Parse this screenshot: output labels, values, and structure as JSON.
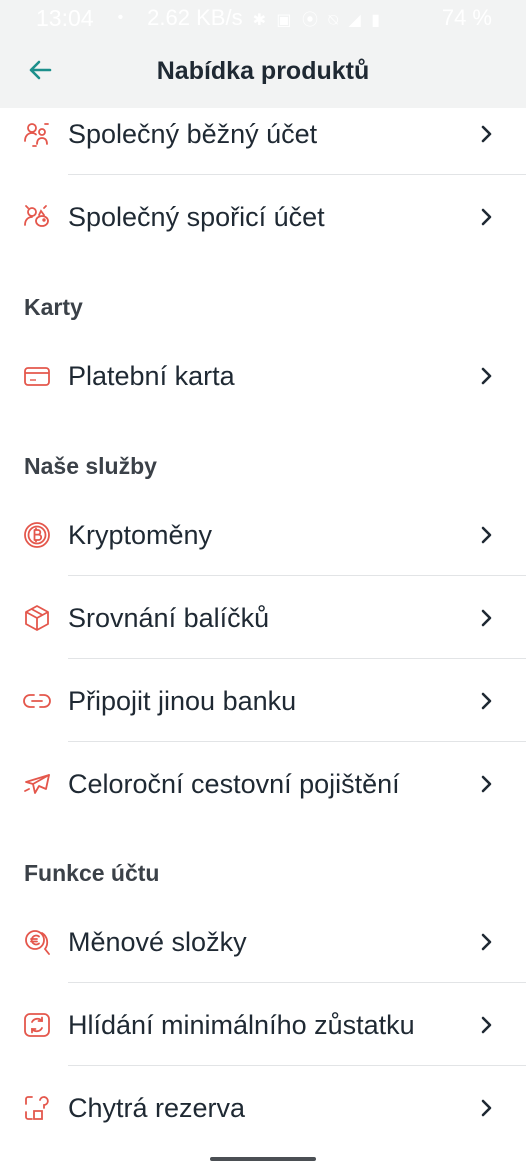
{
  "status_bar": {
    "time": "13:04",
    "dot": "•",
    "speed": "2.62 KB/s",
    "battery": "74 %"
  },
  "app_bar": {
    "title": "Nabídka produktů"
  },
  "colors": {
    "accent": "#e4574c",
    "back_arrow": "#1c8f8b",
    "header_bg": "#f2f3f3"
  },
  "rows": [
    {
      "label": "Společný běžný účet",
      "icon": "joint-current-account-icon"
    },
    {
      "label": "Společný spořicí účet",
      "icon": "joint-savings-account-icon"
    },
    {
      "label": "Platební karta",
      "icon": "payment-card-icon"
    },
    {
      "label": "Kryptoměny",
      "icon": "bitcoin-icon"
    },
    {
      "label": "Srovnání balíčků",
      "icon": "package-box-icon"
    },
    {
      "label": "Připojit jinou banku",
      "icon": "link-icon"
    },
    {
      "label": "Celoroční cestovní pojištění",
      "icon": "airplane-icon"
    },
    {
      "label": "Měnové složky",
      "icon": "currency-folder-icon"
    },
    {
      "label": "Hlídání minimálního zůstatku",
      "icon": "balance-refresh-icon"
    },
    {
      "label": "Chytrá rezerva",
      "icon": "smart-reserve-icon"
    }
  ],
  "sections": {
    "cards": "Karty",
    "services": "Naše služby",
    "account_features": "Funkce účtu"
  }
}
